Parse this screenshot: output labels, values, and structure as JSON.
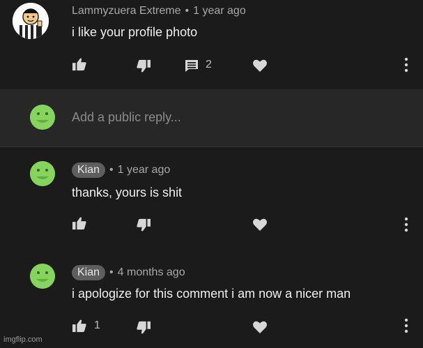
{
  "comments": [
    {
      "author": "Lammyzuera Extreme",
      "time": "1 year ago",
      "text": "i like your profile photo",
      "reply_count": "2",
      "like_count": "",
      "avatar_icon": "referee-cartoon-avatar"
    },
    {
      "author": "Kian",
      "time": "1 year ago",
      "text": "thanks, yours is shit",
      "like_count": "",
      "avatar_icon": "green-blob-avatar"
    },
    {
      "author": "Kian",
      "time": "4 months ago",
      "text": "i apologize for this comment i am now a nicer man",
      "like_count": "1",
      "avatar_icon": "green-blob-avatar"
    }
  ],
  "reply_box": {
    "placeholder": "Add a public reply...",
    "avatar_icon": "green-blob-avatar"
  },
  "separator": "•",
  "watermark": "imgflip.com",
  "colors": {
    "background": "#1b1b1b",
    "reply_bar": "#272727",
    "chip": "#5e5e5e",
    "avatar_green": "#86d45e"
  }
}
